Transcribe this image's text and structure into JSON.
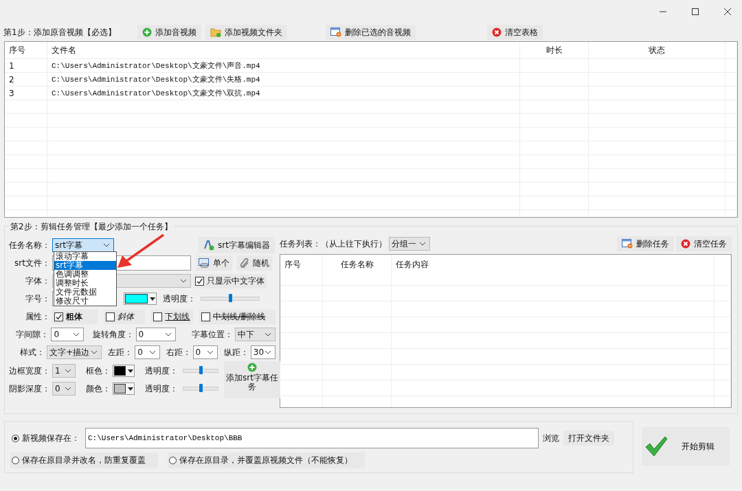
{
  "step1": {
    "label": "第1步：添加原音视频【必选】",
    "buttons": [
      {
        "label": "添加音视频",
        "kind": "add"
      },
      {
        "label": "添加视频文件夹",
        "kind": "folder"
      },
      {
        "label": "删除已选的音视频",
        "kind": "remove"
      },
      {
        "label": "清空表格",
        "kind": "clear"
      }
    ]
  },
  "file_table": {
    "columns": [
      "序号",
      "文件名",
      "时长",
      "状态"
    ],
    "rows": [
      {
        "index": "1",
        "path": "C:\\Users\\Administrator\\Desktop\\文豪文件\\声音.mp4"
      },
      {
        "index": "2",
        "path": "C:\\Users\\Administrator\\Desktop\\文豪文件\\失格.mp4"
      },
      {
        "index": "3",
        "path": "C:\\Users\\Administrator\\Desktop\\文豪文件\\双抗.mp4"
      }
    ]
  },
  "step2": {
    "legend": "第2步：剪辑任务管理【最少添加一个任务】",
    "task_name": {
      "label": "任务名称：",
      "value": "srt字幕"
    },
    "task_options": [
      {
        "label": "滚动字幕",
        "selected": false
      },
      {
        "label": "srt字幕",
        "selected": true
      },
      {
        "label": "色调调整",
        "selected": false
      },
      {
        "label": "调整时长",
        "selected": false
      },
      {
        "label": "文件元数据",
        "selected": false
      },
      {
        "label": "修改尺寸",
        "selected": false
      }
    ],
    "editor_button": "srt字幕编辑器",
    "srt_file_label": "srt文件：",
    "srt_buttons": [
      {
        "label": "单个",
        "kind": "window"
      },
      {
        "label": "随机",
        "kind": "clip"
      }
    ],
    "font_label": "字体：",
    "only_chinese": {
      "label": "只显示中文字体",
      "checked": true
    },
    "size_label": "字号：",
    "font_color": {
      "color": "#00ffff"
    },
    "font_opacity": {
      "label": "透明度：",
      "level": 0.5
    },
    "attr_label": "属性：",
    "attributes": [
      {
        "label": "粗体",
        "checked": true,
        "kind": "bold"
      },
      {
        "label": "斜体",
        "checked": false,
        "kind": "italic"
      },
      {
        "label": "下划线",
        "checked": false,
        "kind": "underline"
      },
      {
        "label": "中划线/删除线",
        "checked": false,
        "kind": "strike"
      }
    ],
    "spacing": {
      "label": "字间隙：",
      "value": "0"
    },
    "rotation": {
      "label": "旋转角度：",
      "value": "0"
    },
    "position": {
      "label": "字幕位置：",
      "value": "中下"
    },
    "style": {
      "label": "样式：",
      "value": "文字+描边"
    },
    "left": {
      "label": "左距：",
      "value": "0"
    },
    "right": {
      "label": "右距：",
      "value": "0"
    },
    "vertical": {
      "label": "纵距：",
      "value": "30"
    },
    "border": {
      "label": "边框宽度：",
      "value": "1",
      "color_label": "框色：",
      "color": "#000000",
      "opacity_label": "透明度：",
      "level": 0.5
    },
    "shadow": {
      "label": "阴影深度：",
      "value": "0",
      "color_label": "颜色：",
      "color": "#c0c0c0",
      "opacity_label": "透明度：",
      "level": 0.5
    },
    "add_button": "添加srt字幕任务"
  },
  "task_list": {
    "label": "任务列表：（从上往下执行）",
    "group": "分组一",
    "buttons": [
      {
        "label": "删除任务",
        "kind": "remove"
      },
      {
        "label": "清空任务",
        "kind": "clear"
      }
    ],
    "columns": [
      "序号",
      "任务名称",
      "任务内容"
    ]
  },
  "output": {
    "options": [
      {
        "label": "新视频保存在：",
        "selected": true,
        "path": "C:\\Users\\Administrator\\Desktop\\BBB"
      },
      {
        "label": "保存在原目录并改名，防重复覆盖",
        "selected": false
      },
      {
        "label": "保存在原目录，并覆盖原视频文件（不能恢复）",
        "selected": false
      }
    ],
    "browse": "浏览",
    "open_folder": "打开文件夹",
    "start": "开始剪辑"
  }
}
